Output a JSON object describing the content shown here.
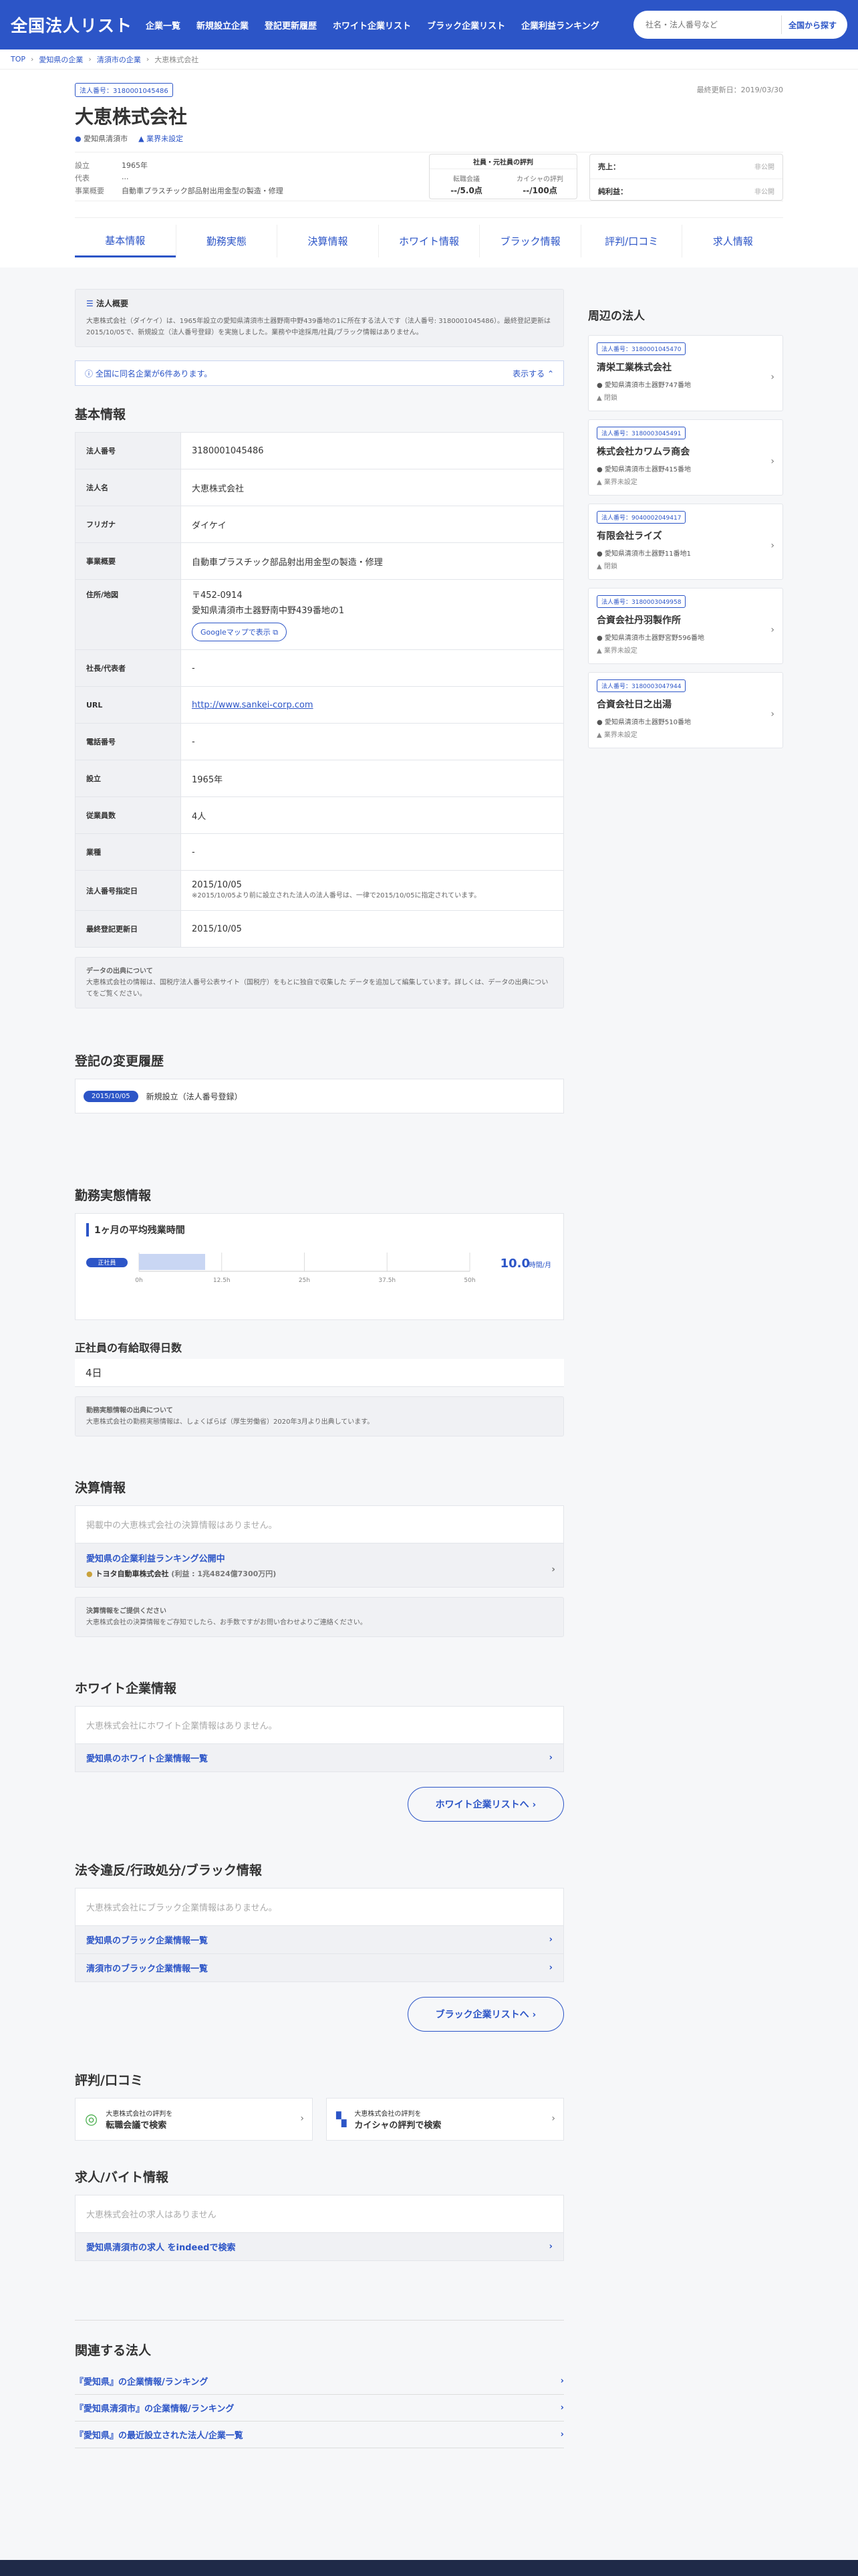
{
  "header": {
    "logo": "全国法人リスト",
    "nav": [
      "企業一覧",
      "新規設立企業",
      "登記更新履歴",
      "ホワイト企業リスト",
      "ブラック企業リスト",
      "企業利益ランキング"
    ],
    "search_placeholder": "社名・法人番号など",
    "search_button": "全国から探す"
  },
  "breadcrumb": [
    "TOP",
    "愛知県の企業",
    "清須市の企業",
    "大恵株式会社"
  ],
  "company": {
    "badge": "法人番号：3180001045486",
    "updated": "最終更新日：2019/03/30",
    "name": "大恵株式会社",
    "location": "愛知県清須市",
    "status_link": "業界未設定",
    "founded_label": "設立",
    "founded": "1965年",
    "rep_label": "代表",
    "rep": "...",
    "business_label": "事業概要",
    "business": "自動車プラスチック部品射出用金型の製造・修理",
    "eval_title": "社員・元社員の評判",
    "eval1_label": "転職会議",
    "eval1": "--/5.0点",
    "eval2_label": "カイシャの評判",
    "eval2": "--/100点",
    "sales_label": "売上：",
    "sales": "非公開",
    "profit_label": "純利益：",
    "profit": "非公開"
  },
  "tabs": [
    "基本情報",
    "勤務実態",
    "決算情報",
    "ホワイト情報",
    "ブラック情報",
    "評判/口コミ",
    "求人情報"
  ],
  "overview": {
    "title": "法人概要",
    "text": "大恵株式会社（ダイケイ）は、1965年設立の愛知県清須市土器野南中野439番地の1に所在する法人です（法人番号: 3180001045486）。最終登記更新は2015/10/05で、新規設立（法人番号登録）を実施しました。業務や中途採用/社員/ブラック情報はありません。"
  },
  "notice": {
    "text": "全国に同名企業が6件あります。",
    "toggle": "表示する ⌃"
  },
  "basic": {
    "title": "基本情報",
    "rows": [
      {
        "k": "法人番号",
        "v": "3180001045486"
      },
      {
        "k": "法人名",
        "v": "大恵株式会社"
      },
      {
        "k": "フリガナ",
        "v": "ダイケイ"
      },
      {
        "k": "事業概要",
        "v": "自動車プラスチック部品射出用金型の製造・修理"
      },
      {
        "k": "住所/地図",
        "v": "〒452-0914"
      },
      {
        "k": "社長/代表者",
        "v": "-"
      },
      {
        "k": "URL",
        "v": "http://www.sankei-corp.com"
      },
      {
        "k": "電話番号",
        "v": "-"
      },
      {
        "k": "設立",
        "v": "1965年"
      },
      {
        "k": "従業員数",
        "v": "4人"
      },
      {
        "k": "業種",
        "v": "-"
      },
      {
        "k": "法人番号指定日",
        "v": "2015/10/05"
      },
      {
        "k": "最終登記更新日",
        "v": "2015/10/05"
      }
    ],
    "address2": "愛知県清須市土器野南中野439番地の1",
    "map_btn": "Googleマップで表示 ⧉",
    "designation_note": "※2015/10/05より前に設立された法人の法人番号は、一律で2015/10/05に指定されています。"
  },
  "source": {
    "title": "データの出典について",
    "text": "大恵株式会社の情報は、国税庁法人番号公表サイト（国税庁）をもとに独自で収集した データを追加して編集しています。詳しくは、データの出典についてをご覧ください。"
  },
  "history": {
    "title": "登記の変更履歴",
    "date": "2015/10/05",
    "event": "新規設立（法人番号登録）"
  },
  "work": {
    "title": "勤務実態情報",
    "overtime_title": "1ヶ月の平均残業時間",
    "bar_label": "正社員",
    "overtime_value": "10.0",
    "overtime_unit": "時間/月",
    "ticks": [
      "0h",
      "12.5h",
      "25h",
      "37.5h",
      "50h"
    ],
    "holiday_title": "正社員の有給取得日数",
    "holiday_value": "4日",
    "source_title": "勤務実態情報の出典について",
    "source_text": "大恵株式会社の勤務実態情報は、しょくばらば（厚生労働省）2020年3月より出典しています。"
  },
  "chart_data": {
    "type": "bar",
    "categories": [
      "正社員"
    ],
    "values": [
      10.0
    ],
    "ylim": [
      0,
      50
    ],
    "ticks": [
      "0h",
      "12.5h",
      "25h",
      "37.5h",
      "50h"
    ]
  },
  "finance": {
    "title": "決算情報",
    "empty": "掲載中の大恵株式会社の決算情報はありません。",
    "ranking_link": "愛知県の企業利益ランキング公開中",
    "ranking_item": "トヨタ自動車株式会社",
    "ranking_value": "(利益 : 1兆4824億7300万円)",
    "req_title": "決算情報をご提供ください",
    "req_text": "大恵株式会社の決算情報をご存知でしたら、お手数ですがお問い合わせよりご連絡ください。"
  },
  "white": {
    "title": "ホワイト企業情報",
    "empty": "大恵株式会社にホワイト企業情報はありません。",
    "link1": "愛知県のホワイト企業情報一覧",
    "btn": "ホワイト企業リストへ ›"
  },
  "black": {
    "title": "法令違反/行政処分/ブラック情報",
    "empty": "大恵株式会社にブラック企業情報はありません。",
    "link1": "愛知県のブラック企業情報一覧",
    "link2": "清須市のブラック企業情報一覧",
    "btn": "ブラック企業リストへ ›"
  },
  "review": {
    "title": "評判/口コミ",
    "c1_small": "大恵株式会社の評判を",
    "c1": "転職会議で検索",
    "c2_small": "大恵株式会社の評判を",
    "c2": "カイシャの評判で検索"
  },
  "jobs": {
    "title": "求人/バイト情報",
    "empty": "大恵株式会社の求人はありません",
    "link": "愛知県清須市の求人 をindeedで検索"
  },
  "related": {
    "title": "関連する法人",
    "links": [
      "『愛知県』の企業情報/ランキング",
      "『愛知県清須市』の企業情報/ランキング",
      "『愛知県』の最近設立された法人/企業一覧"
    ]
  },
  "nearby": {
    "title": "周辺の法人",
    "items": [
      {
        "id": "法人番号：3180001045470",
        "name": "清栄工業株式会社",
        "addr": "愛知県清須市土器野747番地",
        "status": "閉鎖"
      },
      {
        "id": "法人番号：3180003045491",
        "name": "株式会社カワムラ商会",
        "addr": "愛知県清須市土器野415番地",
        "status": "業界未設定"
      },
      {
        "id": "法人番号：9040002049417",
        "name": "有限会社ライズ",
        "addr": "愛知県清須市土器野11番地1",
        "status": "閉鎖"
      },
      {
        "id": "法人番号：3180003049958",
        "name": "合資会社丹羽製作所",
        "addr": "愛知県清須市土器野宮野596番地",
        "status": "業界未設定"
      },
      {
        "id": "法人番号：3180003047944",
        "name": "合資会社日之出湯",
        "addr": "愛知県清須市土器野510番地",
        "status": "業界未設定"
      }
    ]
  }
}
